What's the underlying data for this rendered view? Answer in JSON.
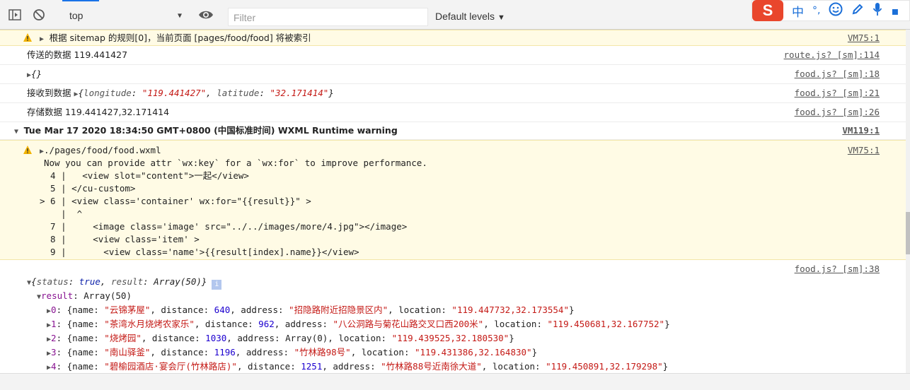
{
  "toolbar": {
    "context_value": "top",
    "filter_placeholder": "Filter",
    "levels_label": "Default levels"
  },
  "ime": {
    "logo": "S",
    "mode": "中",
    "punct": "°,"
  },
  "messages": {
    "m1": {
      "text": "根据 sitemap 的规则[0]，当前页面 [pages/food/food] 将被索引",
      "source": "VM75:1"
    },
    "m2": {
      "text": "传送的数据 119.441427",
      "source": "route.js? [sm]:114"
    },
    "m3": {
      "text": "{}",
      "source": "food.js? [sm]:18"
    },
    "m4": {
      "label": "接收到数据 ",
      "obj_open": "{",
      "k1": "longitude",
      "v1": "\"119.441427\"",
      "k2": "latitude",
      "v2": "\"32.171414\"",
      "obj_close": "}",
      "source": "food.js? [sm]:21"
    },
    "m5": {
      "text": "存储数据 119.441427,32.171414",
      "source": "food.js? [sm]:26"
    },
    "m6": {
      "text": "Tue Mar 17 2020 18:34:50 GMT+0800 (中国标准时间) WXML Runtime warning",
      "source": "VM119:1"
    },
    "m7": {
      "path": "./pages/food/food.wxml",
      "source": "VM75:1",
      "lines": [
        "Now you can provide attr `wx:key` for a `wx:for` to improve performance.",
        "  4 |   <view slot=\"content\">一起</view>",
        "  5 | </cu-custom>",
        "> 6 | <view class='container' wx:for=\"{{result}}\" >",
        "    |  ^",
        "  7 |     <image class='image' src=\"../../images/more/4.jpg\"></image>",
        "  8 |     <view class='item' >",
        "  9 |       <view class='name'>{{result[index].name}}</view>"
      ]
    },
    "m8": {
      "source": "food.js? [sm]:38",
      "summary_status_key": "status",
      "summary_status_val": "true",
      "summary_result_key": "result",
      "summary_result_val": "Array(50)",
      "result_key": "result",
      "result_val": "Array(50)",
      "items": [
        {
          "idx": "0",
          "name": "\"云锦茅屋\"",
          "distance": "640",
          "address": "\"招隐路附近招隐景区内\"",
          "location": "\"119.447732,32.173554\""
        },
        {
          "idx": "1",
          "name": "\"茶湾水月烧烤农家乐\"",
          "distance": "962",
          "address": "\"八公洞路与菊花山路交叉口西200米\"",
          "location": "\"119.450681,32.167752\""
        },
        {
          "idx": "2",
          "name": "\"烧烤园\"",
          "distance": "1030",
          "address": "Array(0)",
          "location": "\"119.439525,32.180530\""
        },
        {
          "idx": "3",
          "name": "\"南山驿釜\"",
          "distance": "1196",
          "address": "\"竹林路98号\"",
          "location": "\"119.431386,32.164830\""
        },
        {
          "idx": "4",
          "name": "\"碧榆园酒店·宴会厅(竹林路店)\"",
          "distance": "1251",
          "address": "\"竹林路88号近南徐大道\"",
          "location": "\"119.450891,32.179298\""
        }
      ]
    }
  }
}
